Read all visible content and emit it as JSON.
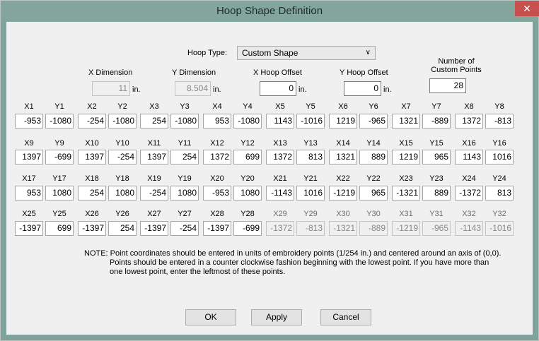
{
  "window": {
    "title": "Hoop Shape Definition",
    "close_glyph": "✕"
  },
  "hoop_type": {
    "label": "Hoop Type:",
    "value": "Custom Shape"
  },
  "x_dimension": {
    "label": "X Dimension",
    "value": "11",
    "unit": "in."
  },
  "y_dimension": {
    "label": "Y Dimension",
    "value": "8.504",
    "unit": "in."
  },
  "x_hoop_offset": {
    "label": "X Hoop Offset",
    "value": "0",
    "unit": "in."
  },
  "y_hoop_offset": {
    "label": "Y Hoop Offset",
    "value": "0",
    "unit": "in."
  },
  "num_points": {
    "label_line1": "Number of",
    "label_line2": "Custom Points",
    "value": "28"
  },
  "points": [
    {
      "xl": "X1",
      "x": "-953",
      "yl": "Y1",
      "y": "-1080"
    },
    {
      "xl": "X2",
      "x": "-254",
      "yl": "Y2",
      "y": "-1080"
    },
    {
      "xl": "X3",
      "x": "254",
      "yl": "Y3",
      "y": "-1080"
    },
    {
      "xl": "X4",
      "x": "953",
      "yl": "Y4",
      "y": "-1080"
    },
    {
      "xl": "X5",
      "x": "1143",
      "yl": "Y5",
      "y": "-1016"
    },
    {
      "xl": "X6",
      "x": "1219",
      "yl": "Y6",
      "y": "-965"
    },
    {
      "xl": "X7",
      "x": "1321",
      "yl": "Y7",
      "y": "-889"
    },
    {
      "xl": "X8",
      "x": "1372",
      "yl": "Y8",
      "y": "-813"
    },
    {
      "xl": "X9",
      "x": "1397",
      "yl": "Y9",
      "y": "-699"
    },
    {
      "xl": "X10",
      "x": "1397",
      "yl": "Y10",
      "y": "-254"
    },
    {
      "xl": "X11",
      "x": "1397",
      "yl": "Y11",
      "y": "254"
    },
    {
      "xl": "X12",
      "x": "1372",
      "yl": "Y12",
      "y": "699"
    },
    {
      "xl": "X13",
      "x": "1372",
      "yl": "Y13",
      "y": "813"
    },
    {
      "xl": "X14",
      "x": "1321",
      "yl": "Y14",
      "y": "889"
    },
    {
      "xl": "X15",
      "x": "1219",
      "yl": "Y15",
      "y": "965"
    },
    {
      "xl": "X16",
      "x": "1143",
      "yl": "Y16",
      "y": "1016"
    },
    {
      "xl": "X17",
      "x": "953",
      "yl": "Y17",
      "y": "1080"
    },
    {
      "xl": "X18",
      "x": "254",
      "yl": "Y18",
      "y": "1080"
    },
    {
      "xl": "X19",
      "x": "-254",
      "yl": "Y19",
      "y": "1080"
    },
    {
      "xl": "X20",
      "x": "-953",
      "yl": "Y20",
      "y": "1080"
    },
    {
      "xl": "X21",
      "x": "-1143",
      "yl": "Y21",
      "y": "1016"
    },
    {
      "xl": "X22",
      "x": "-1219",
      "yl": "Y22",
      "y": "965"
    },
    {
      "xl": "X23",
      "x": "-1321",
      "yl": "Y23",
      "y": "889"
    },
    {
      "xl": "X24",
      "x": "-1372",
      "yl": "Y24",
      "y": "813"
    },
    {
      "xl": "X25",
      "x": "-1397",
      "yl": "Y25",
      "y": "699"
    },
    {
      "xl": "X26",
      "x": "-1397",
      "yl": "Y26",
      "y": "254"
    },
    {
      "xl": "X27",
      "x": "-1397",
      "yl": "Y27",
      "y": "-254"
    },
    {
      "xl": "X28",
      "x": "-1397",
      "yl": "Y28",
      "y": "-699"
    },
    {
      "xl": "X29",
      "x": "-1372",
      "yl": "Y29",
      "y": "-813"
    },
    {
      "xl": "X30",
      "x": "-1321",
      "yl": "Y30",
      "y": "-889"
    },
    {
      "xl": "X31",
      "x": "-1219",
      "yl": "Y31",
      "y": "-965"
    },
    {
      "xl": "X32",
      "x": "-1143",
      "yl": "Y32",
      "y": "-1016"
    }
  ],
  "note": {
    "line1": "NOTE:  Point coordinates should be entered in units of embroidery points (1/254 in.) and centered around an axis of (0,0).",
    "line2": "Points should be entered in a counter clockwise fashion beginning with the lowest point.  If you have more than",
    "line3": "one lowest point, enter the leftmost of these points."
  },
  "buttons": {
    "ok": "OK",
    "apply": "Apply",
    "cancel": "Cancel"
  }
}
